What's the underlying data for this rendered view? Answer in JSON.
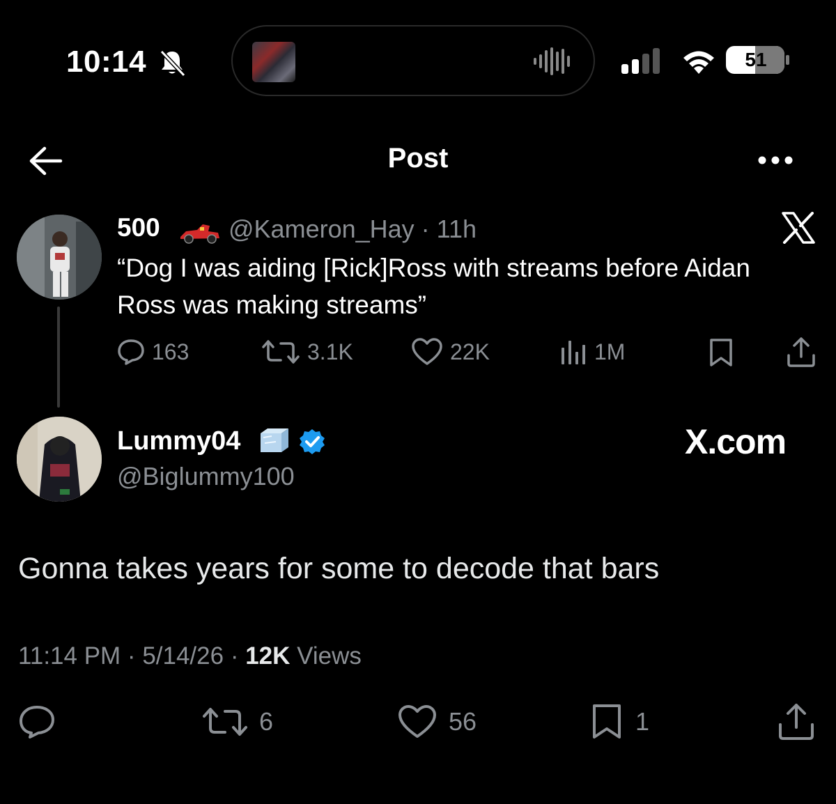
{
  "status_bar": {
    "time": "10:14",
    "battery": "51"
  },
  "header": {
    "title": "Post"
  },
  "quoted_tweet": {
    "display_name": "500",
    "handle_time": "@Kameron_Hay · 11h",
    "text": "“Dog I was aiding [Rick]Ross with streams before Aidan Ross was making streams”",
    "replies": "163",
    "reposts": "3.1K",
    "likes": "22K",
    "views": "1M"
  },
  "main_tweet": {
    "display_name": "Lummy04",
    "handle": "@Biglummy100",
    "watermark": "X.com",
    "text": "Gonna takes years for some to decode that bars",
    "time_date": "11:14 PM · 5/14/26 · ",
    "views_count": "12K",
    "views_label": " Views",
    "reposts": "6",
    "likes": "56",
    "bookmarks": "1"
  },
  "icons": [
    "bell-muted-icon",
    "back-arrow-icon",
    "more-icon",
    "x-logo-icon",
    "reply-icon",
    "repost-icon",
    "like-icon",
    "views-icon",
    "bookmark-icon",
    "share-icon",
    "verified-icon",
    "ice-cube-icon",
    "race-car-icon",
    "signal-icon",
    "wifi-icon",
    "battery-icon"
  ],
  "colors": {
    "background": "#000000",
    "text": "#e7e9ea",
    "muted": "#8b8f94",
    "verified": "#1d9bf0"
  }
}
